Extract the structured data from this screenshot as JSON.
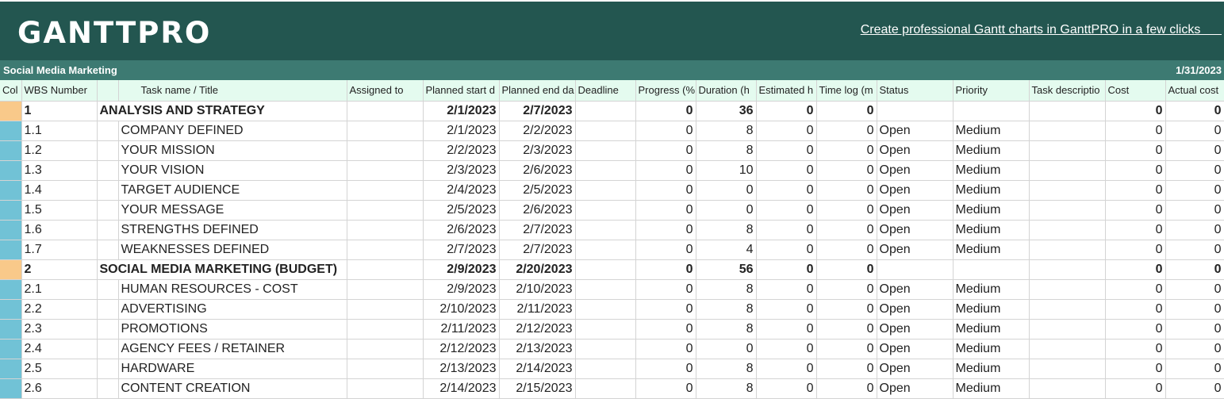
{
  "header": {
    "logo": "GANTTPRO",
    "promo_link": "Create professional Gantt charts in GanttPRO in a few clicks      "
  },
  "project": {
    "name": "Social Media Marketing",
    "date": "1/31/2023"
  },
  "columns": [
    "Col",
    "WBS Number",
    "",
    "Task name / Title",
    "Assigned to",
    "Planned start d",
    "Planned end da",
    "Deadline",
    "Progress (%",
    "Duration  (h",
    "Estimated h",
    "Time log (m",
    "Status",
    "Priority",
    "Task descriptio",
    "Cost",
    "Actual cost"
  ],
  "colors": {
    "banner": "#235650",
    "project_bar": "#3d7a72",
    "header_row": "#e4fbef",
    "group_color": "#f9c98a",
    "task_color": "#71c2d6"
  },
  "rows": [
    {
      "type": "group",
      "wbs": "1",
      "title": "ANALYSIS AND STRATEGY",
      "assigned": "",
      "start": "2/1/2023",
      "end": "2/7/2023",
      "deadline": "",
      "progress": "0",
      "duration": "36",
      "estimated": "0",
      "timelog": "0",
      "status": "",
      "priority": "",
      "description": "",
      "cost": "0",
      "actual": "0"
    },
    {
      "type": "task",
      "wbs": "1.1",
      "title": "COMPANY DEFINED",
      "assigned": "",
      "start": "2/1/2023",
      "end": "2/2/2023",
      "deadline": "",
      "progress": "0",
      "duration": "8",
      "estimated": "0",
      "timelog": "0",
      "status": "Open",
      "priority": "Medium",
      "description": "",
      "cost": "0",
      "actual": "0"
    },
    {
      "type": "task",
      "wbs": "1.2",
      "title": "YOUR MISSION",
      "assigned": "",
      "start": "2/2/2023",
      "end": "2/3/2023",
      "deadline": "",
      "progress": "0",
      "duration": "8",
      "estimated": "0",
      "timelog": "0",
      "status": "Open",
      "priority": "Medium",
      "description": "",
      "cost": "0",
      "actual": "0"
    },
    {
      "type": "task",
      "wbs": "1.3",
      "title": "YOUR VISION",
      "assigned": "",
      "start": "2/3/2023",
      "end": "2/6/2023",
      "deadline": "",
      "progress": "0",
      "duration": "10",
      "estimated": "0",
      "timelog": "0",
      "status": "Open",
      "priority": "Medium",
      "description": "",
      "cost": "0",
      "actual": "0"
    },
    {
      "type": "task",
      "wbs": "1.4",
      "title": "TARGET AUDIENCE",
      "assigned": "",
      "start": "2/4/2023",
      "end": "2/5/2023",
      "deadline": "",
      "progress": "0",
      "duration": "0",
      "estimated": "0",
      "timelog": "0",
      "status": "Open",
      "priority": "Medium",
      "description": "",
      "cost": "0",
      "actual": "0"
    },
    {
      "type": "task",
      "wbs": "1.5",
      "title": "YOUR MESSAGE",
      "assigned": "",
      "start": "2/5/2023",
      "end": "2/6/2023",
      "deadline": "",
      "progress": "0",
      "duration": "0",
      "estimated": "0",
      "timelog": "0",
      "status": "Open",
      "priority": "Medium",
      "description": "",
      "cost": "0",
      "actual": "0"
    },
    {
      "type": "task",
      "wbs": "1.6",
      "title": "STRENGTHS DEFINED",
      "assigned": "",
      "start": "2/6/2023",
      "end": "2/7/2023",
      "deadline": "",
      "progress": "0",
      "duration": "8",
      "estimated": "0",
      "timelog": "0",
      "status": "Open",
      "priority": "Medium",
      "description": "",
      "cost": "0",
      "actual": "0"
    },
    {
      "type": "task",
      "wbs": "1.7",
      "title": "WEAKNESSES DEFINED",
      "assigned": "",
      "start": "2/7/2023",
      "end": "2/7/2023",
      "deadline": "",
      "progress": "0",
      "duration": "4",
      "estimated": "0",
      "timelog": "0",
      "status": "Open",
      "priority": "Medium",
      "description": "",
      "cost": "0",
      "actual": "0"
    },
    {
      "type": "group",
      "wbs": "2",
      "title": "SOCIAL MEDIA MARKETING (BUDGET)",
      "assigned": "",
      "start": "2/9/2023",
      "end": "2/20/2023",
      "deadline": "",
      "progress": "0",
      "duration": "56",
      "estimated": "0",
      "timelog": "0",
      "status": "",
      "priority": "",
      "description": "",
      "cost": "0",
      "actual": "0"
    },
    {
      "type": "task",
      "wbs": "2.1",
      "title": "HUMAN RESOURCES - COST",
      "assigned": "",
      "start": "2/9/2023",
      "end": "2/10/2023",
      "deadline": "",
      "progress": "0",
      "duration": "8",
      "estimated": "0",
      "timelog": "0",
      "status": "Open",
      "priority": "Medium",
      "description": "",
      "cost": "0",
      "actual": "0"
    },
    {
      "type": "task",
      "wbs": "2.2",
      "title": "ADVERTISING",
      "assigned": "",
      "start": "2/10/2023",
      "end": "2/11/2023",
      "deadline": "",
      "progress": "0",
      "duration": "8",
      "estimated": "0",
      "timelog": "0",
      "status": "Open",
      "priority": "Medium",
      "description": "",
      "cost": "0",
      "actual": "0"
    },
    {
      "type": "task",
      "wbs": "2.3",
      "title": "PROMOTIONS",
      "assigned": "",
      "start": "2/11/2023",
      "end": "2/12/2023",
      "deadline": "",
      "progress": "0",
      "duration": "8",
      "estimated": "0",
      "timelog": "0",
      "status": "Open",
      "priority": "Medium",
      "description": "",
      "cost": "0",
      "actual": "0"
    },
    {
      "type": "task",
      "wbs": "2.4",
      "title": "AGENCY FEES / RETAINER",
      "assigned": "",
      "start": "2/12/2023",
      "end": "2/13/2023",
      "deadline": "",
      "progress": "0",
      "duration": "0",
      "estimated": "0",
      "timelog": "0",
      "status": "Open",
      "priority": "Medium",
      "description": "",
      "cost": "0",
      "actual": "0"
    },
    {
      "type": "task",
      "wbs": "2.5",
      "title": "HARDWARE",
      "assigned": "",
      "start": "2/13/2023",
      "end": "2/14/2023",
      "deadline": "",
      "progress": "0",
      "duration": "8",
      "estimated": "0",
      "timelog": "0",
      "status": "Open",
      "priority": "Medium",
      "description": "",
      "cost": "0",
      "actual": "0"
    },
    {
      "type": "task",
      "wbs": "2.6",
      "title": "CONTENT CREATION",
      "assigned": "",
      "start": "2/14/2023",
      "end": "2/15/2023",
      "deadline": "",
      "progress": "0",
      "duration": "8",
      "estimated": "0",
      "timelog": "0",
      "status": "Open",
      "priority": "Medium",
      "description": "",
      "cost": "0",
      "actual": "0"
    }
  ]
}
